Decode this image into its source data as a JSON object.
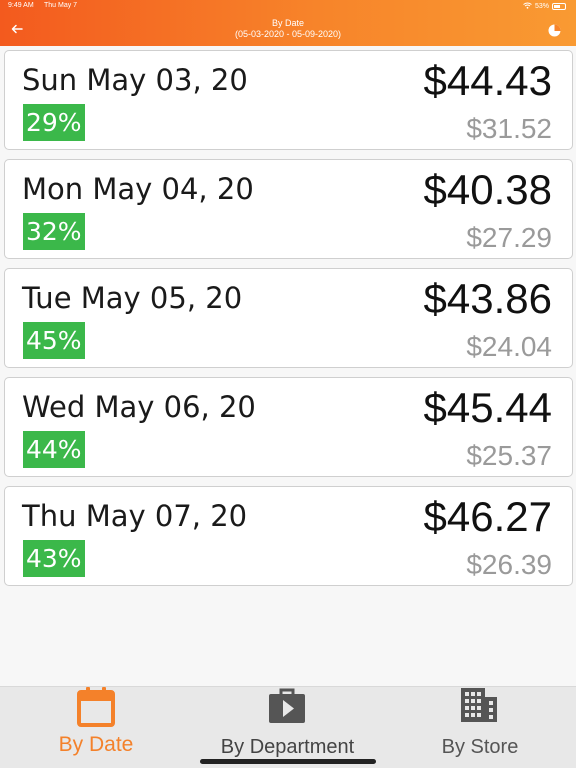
{
  "status_bar": {
    "time": "9:49 AM",
    "day": "Thu May 7",
    "battery": "53%"
  },
  "header": {
    "title": "By Date",
    "subtitle": "(05-03-2020 - 05-09-2020)"
  },
  "rows": [
    {
      "date": "Sun May 03, 20",
      "percent": "29%",
      "amount": "$44.43",
      "sub_amount": "$31.52"
    },
    {
      "date": "Mon May 04, 20",
      "percent": "32%",
      "amount": "$40.38",
      "sub_amount": "$27.29"
    },
    {
      "date": "Tue May 05, 20",
      "percent": "45%",
      "amount": "$43.86",
      "sub_amount": "$24.04"
    },
    {
      "date": "Wed May 06, 20",
      "percent": "44%",
      "amount": "$45.44",
      "sub_amount": "$25.37"
    },
    {
      "date": "Thu May 07, 20",
      "percent": "43%",
      "amount": "$46.27",
      "sub_amount": "$26.39"
    }
  ],
  "tabs": {
    "by_date": "By Date",
    "by_department": "By Department",
    "by_store": "By Store"
  },
  "colors": {
    "accent": "#f4812a",
    "badge": "#3bb84a",
    "icon_gray": "#555555"
  },
  "icons": {
    "back": "arrow-left-icon",
    "chart": "pie-chart-icon",
    "date_tab": "calendar-icon",
    "department_tab": "briefcase-play-icon",
    "store_tab": "building-icon"
  }
}
